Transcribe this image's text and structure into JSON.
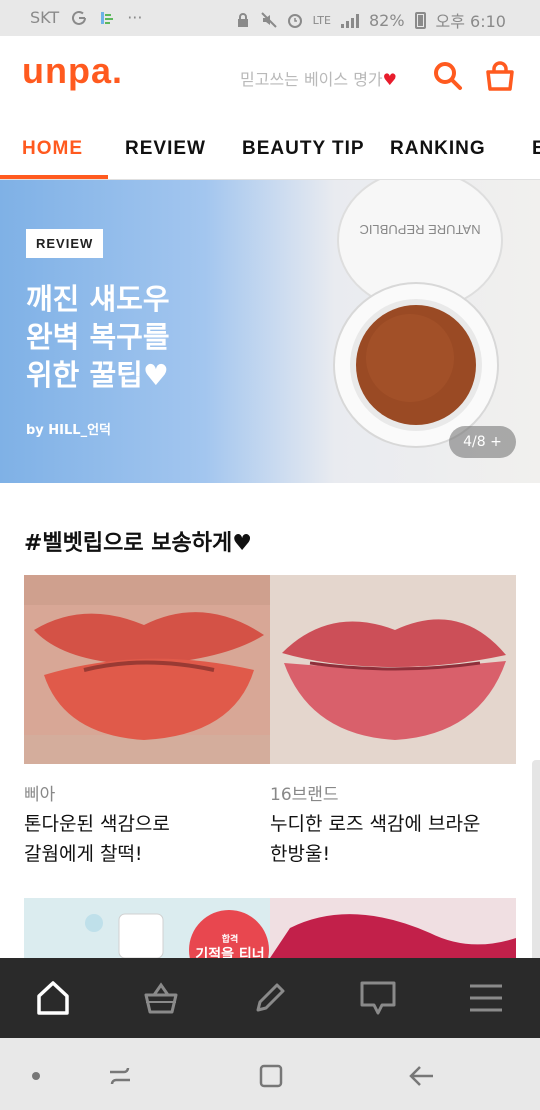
{
  "status_bar": {
    "carrier": "SKT",
    "network": "LTE",
    "battery": "82%",
    "time": "오후 6:10"
  },
  "header": {
    "logo": "unpa.",
    "tagline": "믿고쓰는 베이스 명가",
    "heart": "♥",
    "search_icon": "search-icon",
    "cart_icon": "shopping-bag-icon",
    "brand_color": "#ff5a1f"
  },
  "nav": {
    "tabs": [
      {
        "label": "HOME"
      },
      {
        "label": "REVIEW"
      },
      {
        "label": "BEAUTY TIP"
      },
      {
        "label": "RANKING"
      },
      {
        "label": "E"
      }
    ],
    "active_tab": "HOME"
  },
  "banner": {
    "tag": "REVIEW",
    "title": "깨진 섀도우\n완벽 복구를\n위한 꿀팁♥",
    "author": "by HILL_언덕",
    "counter": "4/8 +",
    "product_text": "NATURE REPUBLIC"
  },
  "section": {
    "title": "#벨벳립으로 보송하게♥",
    "cards": [
      {
        "brand": "삐아",
        "desc": "톤다운된 색감으로\n갈웜에게 찰떡!"
      },
      {
        "brand": "16브랜드",
        "desc": "누디한 로즈 색감에 브라운\n한방울!"
      }
    ],
    "peek_badge_top": "합격",
    "peek_badge_text": "기적을 티너"
  },
  "app_bar": {
    "items": [
      "home-icon",
      "basket-icon",
      "pencil-icon",
      "chat-icon",
      "menu-icon"
    ]
  },
  "system_nav": {
    "items": [
      "dot-icon",
      "recents-icon",
      "home-square-icon",
      "back-icon"
    ]
  }
}
